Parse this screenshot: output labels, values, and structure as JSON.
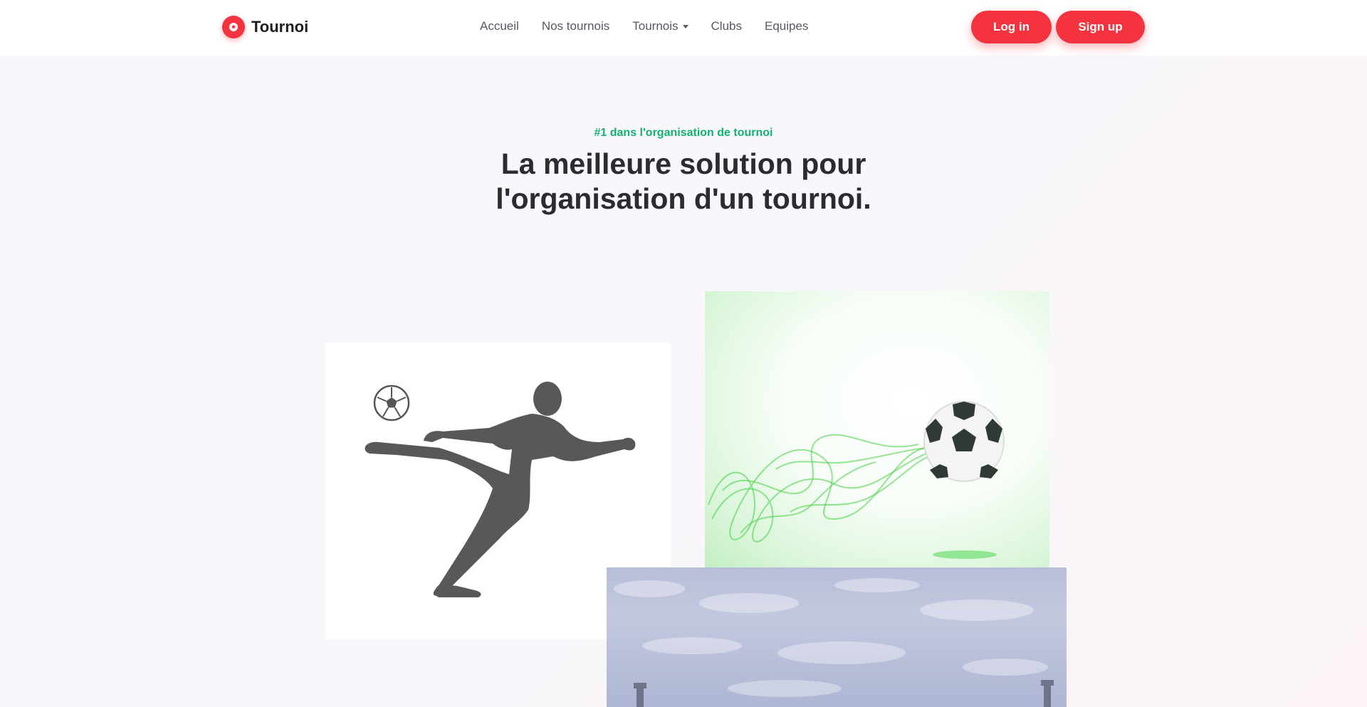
{
  "brand": {
    "name": "Tournoi",
    "logo_icon": "soccer-ball-icon",
    "accent": "#f5333f"
  },
  "nav": {
    "items": [
      {
        "label": "Accueil"
      },
      {
        "label": "Nos tournois"
      },
      {
        "label": "Tournois",
        "has_dropdown": true
      },
      {
        "label": "Clubs"
      },
      {
        "label": "Equipes"
      }
    ]
  },
  "auth": {
    "login_label": "Log in",
    "signup_label": "Sign up"
  },
  "hero": {
    "eyebrow": "#1 dans l'organisation de tournoi",
    "eyebrow_color": "#12b16f",
    "title_line1": "La meilleure solution pour",
    "title_line2": "l'organisation d'un tournoi."
  },
  "images": [
    {
      "name": "footballer-silhouette",
      "description_icon": "footballer-kick-icon"
    },
    {
      "name": "soccer-ball-green-smoke",
      "description_icon": "soccer-ball-icon"
    },
    {
      "name": "stadium-sky",
      "description_icon": "stadium-icon"
    }
  ]
}
